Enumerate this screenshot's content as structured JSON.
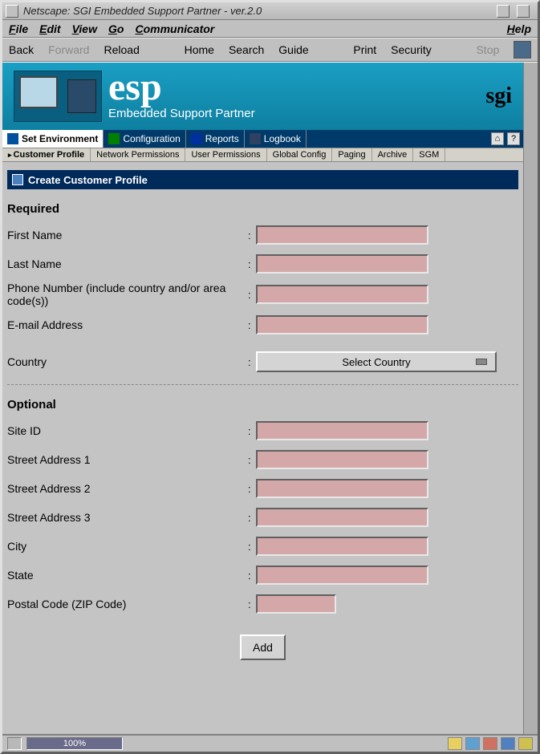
{
  "window": {
    "title": "Netscape: SGI Embedded Support Partner - ver.2.0"
  },
  "menubar": {
    "file": "File",
    "edit": "Edit",
    "view": "View",
    "go": "Go",
    "communicator": "Communicator",
    "help": "Help"
  },
  "toolbar": {
    "back": "Back",
    "forward": "Forward",
    "reload": "Reload",
    "home": "Home",
    "search": "Search",
    "guide": "Guide",
    "print": "Print",
    "security": "Security",
    "stop": "Stop"
  },
  "banner": {
    "product": "esp",
    "subtitle": "Embedded Support Partner",
    "brand": "sgi"
  },
  "nav1": {
    "set_env": "Set Environment",
    "config": "Configuration",
    "reports": "Reports",
    "logbook": "Logbook"
  },
  "nav2": {
    "cust_profile": "Customer Profile",
    "net_perm": "Network Permissions",
    "user_perm": "User Permissions",
    "global": "Global Config",
    "paging": "Paging",
    "archive": "Archive",
    "sgm": "SGM"
  },
  "panel": {
    "title": "Create Customer Profile"
  },
  "sections": {
    "required": "Required",
    "optional": "Optional"
  },
  "fields": {
    "first_name": "First Name",
    "last_name": "Last Name",
    "phone": "Phone Number (include country and/or area code(s))",
    "email": "E-mail Address",
    "country": "Country",
    "country_select": "Select Country",
    "site_id": "Site ID",
    "addr1": "Street Address 1",
    "addr2": "Street Address 2",
    "addr3": "Street Address 3",
    "city": "City",
    "state": "State",
    "postal": "Postal Code (ZIP Code)"
  },
  "buttons": {
    "add": "Add"
  },
  "status": {
    "zoom": "100%"
  }
}
